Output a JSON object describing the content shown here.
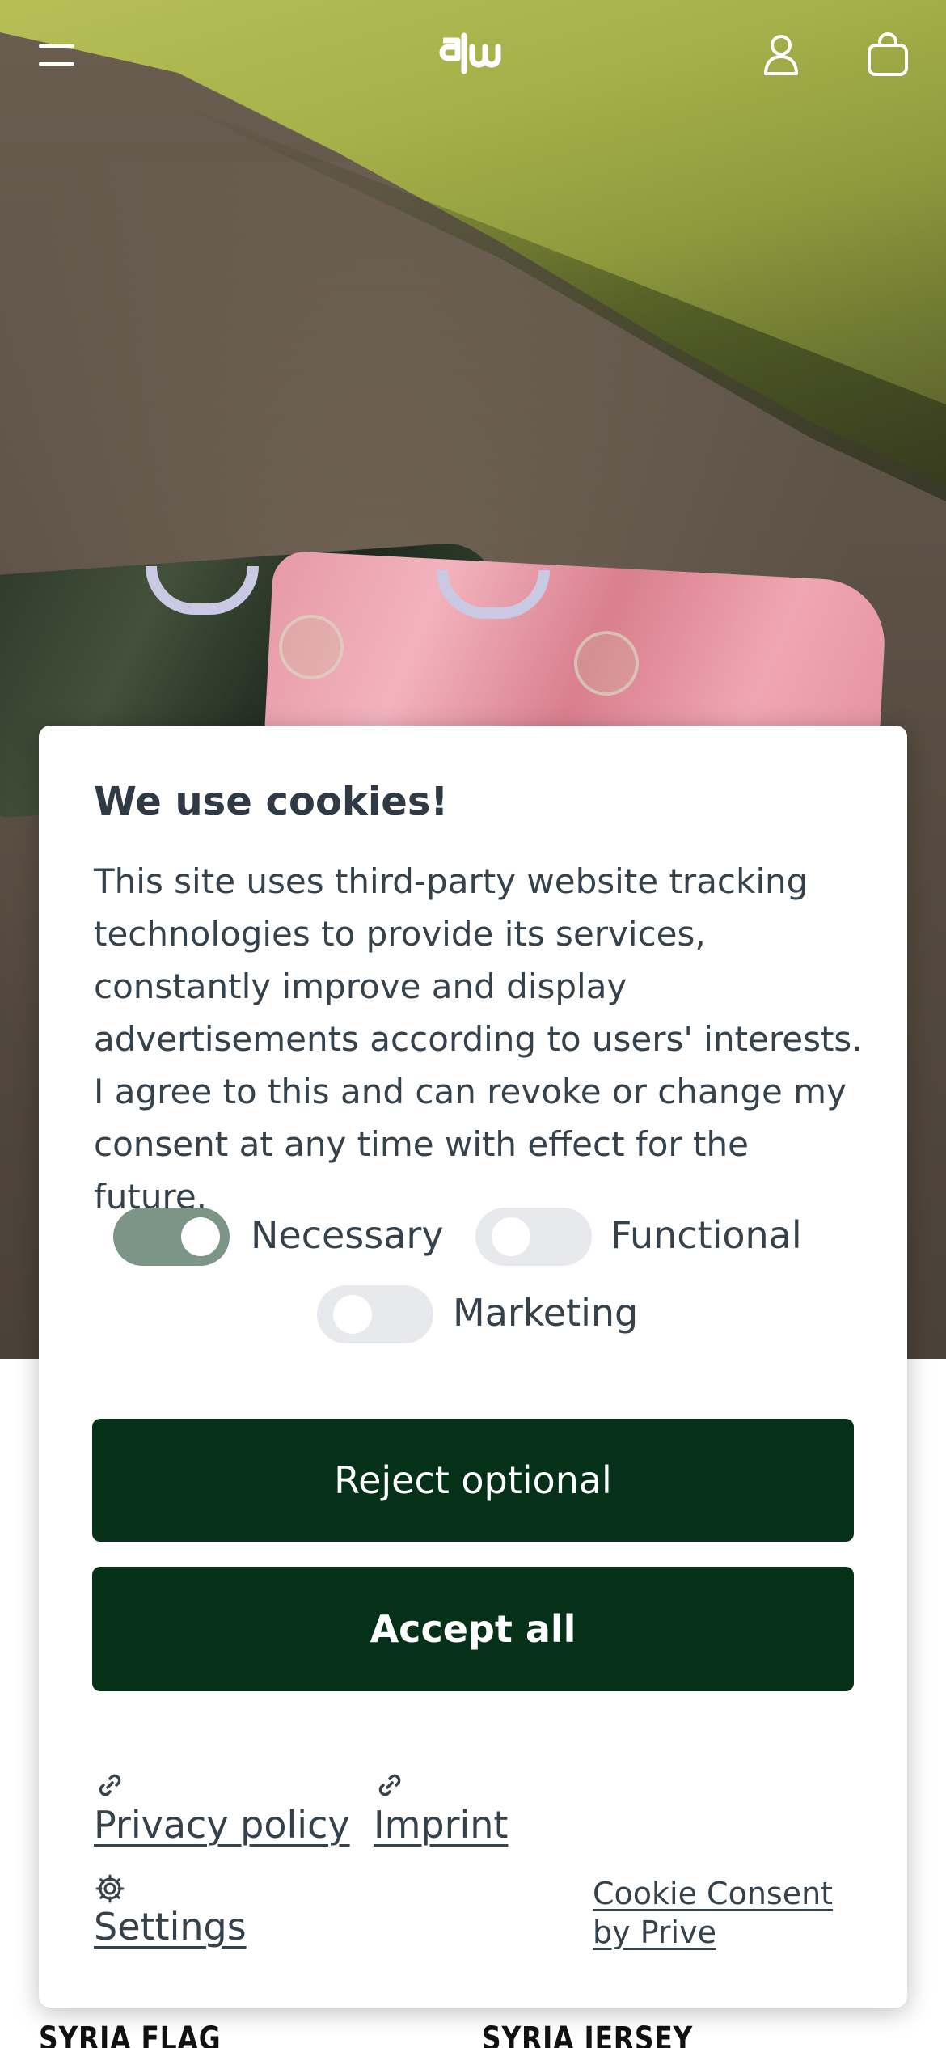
{
  "header": {
    "menu_icon": "hamburger-menu-icon",
    "logo_name": "brand-logo",
    "account_icon": "user-account-icon",
    "cart_icon": "shopping-bag-icon"
  },
  "products": [
    {
      "title": "SYRIA FLAG"
    },
    {
      "title": "SYRIA JERSEY"
    }
  ],
  "cookie_banner": {
    "title": "We use cookies!",
    "text": "This site uses third-party website tracking technologies to provide its services, constantly improve and display advertisements according to users' interests. I agree to this and can revoke or change my consent at any time with effect for the future.",
    "toggles": [
      {
        "label": "Necessary",
        "on": true
      },
      {
        "label": "Functional",
        "on": false
      },
      {
        "label": "Marketing",
        "on": false
      }
    ],
    "reject_label": "Reject optional",
    "accept_label": "Accept all",
    "privacy_label": "Privacy policy",
    "imprint_label": "Imprint",
    "settings_label": "Settings",
    "consent_by_label": "Cookie Consent by Prive"
  },
  "colors": {
    "button_bg": "#053119",
    "toggle_on": "#7c9586",
    "toggle_off": "#e7e9ec",
    "text": "#35414b"
  }
}
